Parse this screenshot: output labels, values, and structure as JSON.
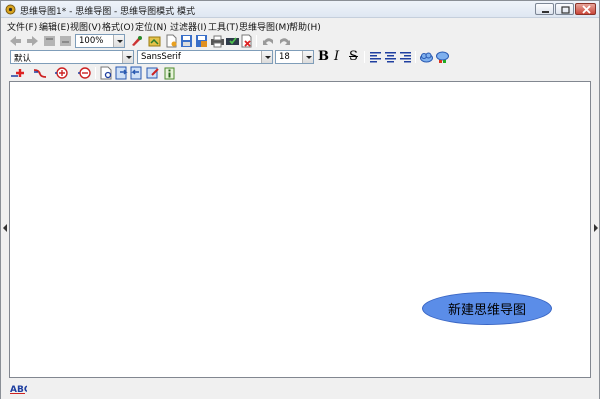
{
  "window": {
    "title": "思维导图1* - 思维导图 - 思维导图模式 模式"
  },
  "menubar": {
    "items": [
      "文件(F)",
      "编辑(E)",
      "视图(V)",
      "格式(O)",
      "定位(N)",
      "过滤器(I)",
      "工具(T)",
      "思维导图(M)",
      "帮助(H)"
    ]
  },
  "toolbar": {
    "zoom_value": "100%"
  },
  "format_bar": {
    "style_value": "默认",
    "font_value": "SansSerif",
    "size_value": "18",
    "bold_label": "B",
    "italic_label": "I",
    "strike_label": "S"
  },
  "mindmap": {
    "root_node": "新建思维导图",
    "root_color": "#5b8de8"
  },
  "statusbar": {
    "spell_label": "ABC"
  }
}
